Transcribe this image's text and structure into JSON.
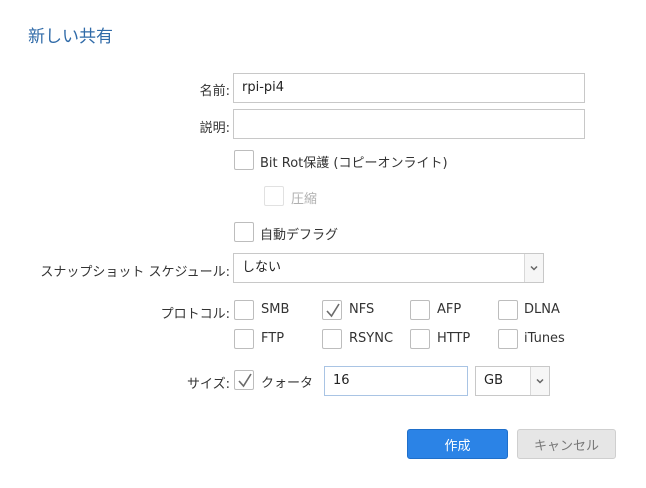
{
  "dialog": {
    "title": "新しい共有"
  },
  "form": {
    "name": {
      "label": "名前:",
      "value": "rpi-pi4"
    },
    "description": {
      "label": "説明:",
      "value": ""
    },
    "bitrot": {
      "label": "Bit Rot保護 (コピーオンライト)",
      "checked": false
    },
    "compression": {
      "label": "圧縮",
      "checked": false,
      "disabled": true
    },
    "autodefrag": {
      "label": "自動デフラグ",
      "checked": false
    },
    "snapshot": {
      "label": "スナップショット スケジュール:",
      "value": "しない"
    },
    "protocols": {
      "label": "プロトコル:",
      "items": [
        {
          "label": "SMB",
          "checked": false
        },
        {
          "label": "NFS",
          "checked": true
        },
        {
          "label": "AFP",
          "checked": false
        },
        {
          "label": "DLNA",
          "checked": false
        },
        {
          "label": "FTP",
          "checked": false
        },
        {
          "label": "RSYNC",
          "checked": false
        },
        {
          "label": "HTTP",
          "checked": false
        },
        {
          "label": "iTunes",
          "checked": false
        }
      ]
    },
    "size": {
      "label": "サイズ:",
      "quota_label": "クォータ",
      "quota_checked": true,
      "value": "16",
      "unit": "GB"
    }
  },
  "buttons": {
    "create": "作成",
    "cancel": "キャンセル"
  },
  "colors": {
    "title": "#2f6aa8",
    "primary": "#2b83e6",
    "check": "#6b6b6b"
  },
  "icons": {
    "check": "checkmark-icon",
    "dropdown": "chevron-down-icon"
  }
}
